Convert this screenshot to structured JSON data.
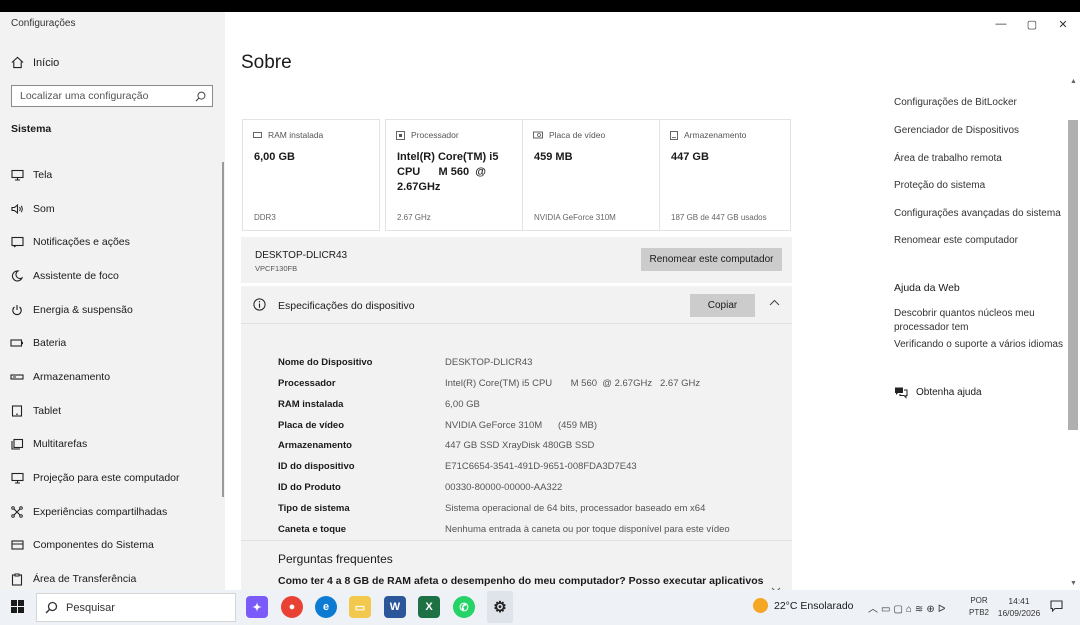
{
  "window": {
    "app_title": "Configurações",
    "controls": [
      "—",
      "▢",
      "✕"
    ]
  },
  "sidebar": {
    "home_label": "Início",
    "search_placeholder": "Localizar uma configuração",
    "section": "Sistema",
    "items": [
      {
        "label": "Tela",
        "icon": "display-icon"
      },
      {
        "label": "Som",
        "icon": "speaker-icon"
      },
      {
        "label": "Notificações e ações",
        "icon": "notification-icon"
      },
      {
        "label": "Assistente de foco",
        "icon": "moon-icon"
      },
      {
        "label": "Energia & suspensão",
        "icon": "power-icon"
      },
      {
        "label": "Bateria",
        "icon": "battery-icon"
      },
      {
        "label": "Armazenamento",
        "icon": "storage-icon"
      },
      {
        "label": "Tablet",
        "icon": "tablet-icon"
      },
      {
        "label": "Multitarefas",
        "icon": "multitask-icon"
      },
      {
        "label": "Projeção para este computador",
        "icon": "projection-icon"
      },
      {
        "label": "Experiências compartilhadas",
        "icon": "shared-icon"
      },
      {
        "label": "Componentes do Sistema",
        "icon": "components-icon"
      },
      {
        "label": "Área de Transferência",
        "icon": "clipboard-icon"
      }
    ]
  },
  "main": {
    "title": "Sobre",
    "cards": [
      {
        "label": "RAM instalada",
        "value": "6,00 GB",
        "sub": "DDR3",
        "icon": "ram-icon"
      },
      {
        "label": "Processador",
        "value": "Intel(R) Core(TM) i5\nCPU      M 560  @\n2.67GHz",
        "sub": "2.67 GHz",
        "icon": "processor-icon"
      },
      {
        "label": "Placa de vídeo",
        "value": "459 MB",
        "sub": "NVIDIA GeForce 310M",
        "icon": "gpu-icon"
      },
      {
        "label": "Armazenamento",
        "value": "447 GB",
        "sub": "187 GB de 447 GB usados",
        "icon": "disk-icon"
      }
    ],
    "device": {
      "name": "DESKTOP-DLICR43",
      "model": "VPCF130FB",
      "rename_label": "Renomear este computador"
    },
    "specs": {
      "title": "Especificações do dispositivo",
      "copy_label": "Copiar",
      "rows": [
        {
          "key": "Nome do Dispositivo",
          "value": "DESKTOP-DLICR43"
        },
        {
          "key": "Processador",
          "value": "Intel(R) Core(TM) i5 CPU       M 560  @ 2.67GHz   2.67 GHz"
        },
        {
          "key": "RAM instalada",
          "value": "6,00 GB"
        },
        {
          "key": "Placa de vídeo",
          "value": "NVIDIA GeForce 310M      (459 MB)"
        },
        {
          "key": "Armazenamento",
          "value": "447 GB SSD XrayDisk 480GB SSD"
        },
        {
          "key": "ID do dispositivo",
          "value": "E71C6654-3541-491D-9651-008FDA3D7E43"
        },
        {
          "key": "ID do Produto",
          "value": "00330-80000-00000-AA322"
        },
        {
          "key": "Tipo de sistema",
          "value": "Sistema operacional de 64 bits, processador baseado em x64"
        },
        {
          "key": "Caneta e toque",
          "value": "Nenhuma entrada à caneta ou por toque disponível para este vídeo"
        }
      ]
    },
    "faq": {
      "title": "Perguntas frequentes",
      "question": "Como ter 4 a 8 GB de RAM afeta o desempenho do meu computador? Posso executar aplicativos"
    }
  },
  "related": {
    "links": [
      "Configurações de BitLocker",
      "Gerenciador de Dispositivos",
      "Área de trabalho remota",
      "Proteção do sistema",
      "Configurações avançadas do sistema",
      "Renomear este computador"
    ],
    "web_help_title": "Ajuda da Web",
    "web_links": [
      "Descobrir quantos núcleos meu\nprocessador tem",
      "Verificando o suporte a vários idiomas"
    ],
    "get_help": "Obtenha ajuda"
  },
  "taskbar": {
    "search_label": "Pesquisar",
    "weather": "22°C  Ensolarado",
    "lang_1": "POR",
    "lang_2": "PTB2",
    "time": "14:41",
    "date": "16/09/2026"
  }
}
